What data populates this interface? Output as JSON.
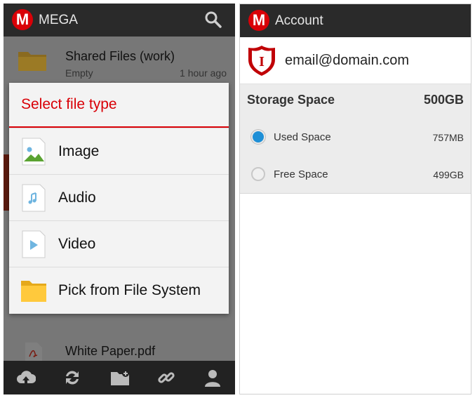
{
  "left": {
    "app_title": "MEGA",
    "logo_letter": "M",
    "list": [
      {
        "name": "Shared Files (work)",
        "subtitle": "Empty",
        "time": "1 hour ago"
      },
      {
        "name": "White Paper.pdf"
      }
    ],
    "dialog": {
      "title": "Select file type",
      "options": [
        {
          "label": "Image",
          "icon": "image-file-icon"
        },
        {
          "label": "Audio",
          "icon": "audio-file-icon"
        },
        {
          "label": "Video",
          "icon": "video-file-icon"
        },
        {
          "label": "Pick from File System",
          "icon": "folder-icon"
        }
      ]
    },
    "toolbar": [
      "upload-icon",
      "sync-icon",
      "new-folder-icon",
      "link-icon",
      "account-icon"
    ]
  },
  "right": {
    "app_title": "Account",
    "logo_letter": "M",
    "email": "email@domain.com",
    "shield_letter": "I",
    "storage": {
      "title": "Storage Space",
      "total": "500GB",
      "rows": [
        {
          "label": "Used Space",
          "value": "757MB",
          "color": "#1e8fd6"
        },
        {
          "label": "Free Space",
          "value": "499GB",
          "color": "#f0f0f0"
        }
      ]
    }
  },
  "colors": {
    "brand_red": "#d90007",
    "topbar": "#2a2a2a"
  }
}
